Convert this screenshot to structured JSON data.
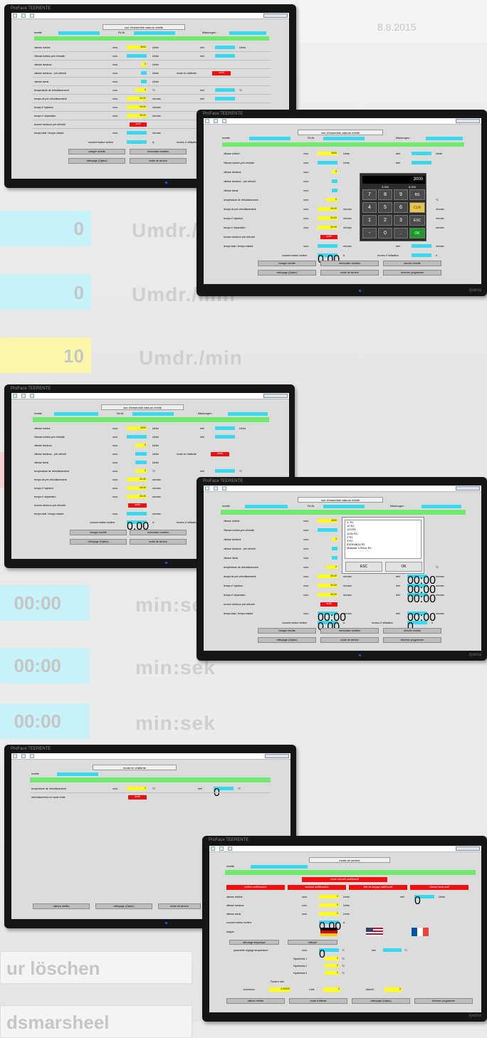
{
  "background": {
    "top_text": "8.8.2015",
    "pill_numbers": [
      "0",
      "0",
      "10"
    ],
    "units": [
      "Umdr./min",
      "Umdr./min",
      "Umdr./min"
    ],
    "times": [
      "00:00",
      "00:00",
      "00:00"
    ],
    "time_units": [
      "min:sek",
      "min:sek",
      "min:sek"
    ],
    "bottom_texts": [
      "ur löschen",
      "dsmarsheel"
    ]
  },
  "monitor": {
    "brand": "ProFace TEERENTE",
    "maker": "iiyama"
  },
  "ui": {
    "title_overview": "vue d'ensemble valeurs /réelle",
    "title_waiting": "mode en d'attente",
    "title_service": "mode de service",
    "recette": "recette",
    "fa_nr": "FA-Nr.",
    "mischungen": "Mischungen :",
    "nom": "nom.",
    "reel": "réel",
    "arret": "arrêt",
    "rows": [
      {
        "label": "vitesse turbine",
        "nom": "3000",
        "unit": "U/min",
        "reel": "0",
        "runit": "U/min"
      },
      {
        "label": "Vitesse turbine-pré-refroidie",
        "nom": "300",
        "unit": "U/min",
        "reel": "0",
        "runit": "U/min"
      },
      {
        "label": "vitesse tambour",
        "nom": "3",
        "unit": "U/min"
      },
      {
        "label": "vitesse tambour - pré-refroidi",
        "nom": "3",
        "unit": "U/min",
        "extra": "mode en d'attente"
      },
      {
        "label": "vitesse tamis",
        "nom": "3",
        "unit": "U/min"
      },
      {
        "label": "température de refroidissement",
        "nom": "0",
        "unit": "°C",
        "reel": "0",
        "runit": "°C"
      },
      {
        "label": "temps de pré-refroidissement",
        "nom": "00:00",
        "unit": "min:sec",
        "reel": "00:00",
        "runit": "min:sec"
      },
      {
        "label": "temps d' injection",
        "nom": "00:00",
        "unit": "min:sec",
        "reel": "00:00",
        "runit": "min:sec"
      },
      {
        "label": "temps d' séparation",
        "nom": "00:00",
        "unit": "min:sec",
        "reel": "00:00",
        "runit": "min:sec"
      },
      {
        "label": "tourner tambour pré-refroidir"
      },
      {
        "label": "temps total / temps restant",
        "nom": "00:00",
        "unit": "min:sec",
        "reel": "00:00",
        "runit": "min:sec"
      }
    ],
    "courant_label": "courant moteur turbine",
    "courant_value": "0,00",
    "courant_unit": "A",
    "heures_label": "heures d' utilisation",
    "heures_value": "0",
    "heures_unit": "h",
    "buttons": [
      "charger recette",
      "mémoriser recettes",
      "annuler recette",
      "nettoyage (Option)",
      "mode de service",
      "terminer programme"
    ],
    "keypad": {
      "display": "3000",
      "min": "3.000",
      "max": "6.000",
      "keys": [
        "7",
        "8",
        "9",
        "BS",
        "4",
        "5",
        "6",
        "CLR",
        "1",
        "2",
        "3",
        "ESC",
        "-",
        "0",
        ".",
        "OK"
      ]
    },
    "recipe_list": [
      "1. R1",
      "12 R1",
      "123 R1",
      "1234 R1",
      "2 R1",
      "3 R1",
      "ID0304814 R1",
      "Material 1234ov R1"
    ],
    "dialog_buttons": [
      "ESC",
      "OK"
    ],
    "waiting": {
      "row1": "température de refroidissement",
      "row1_nom": "0",
      "row1_unit": "°C",
      "row1_reel": "0",
      "row2": "refroidissement en mode d'idle",
      "bottom": [
        "valeurs réelles",
        "nettoyage (Option)",
        "mode de service"
      ]
    },
    "service": {
      "header": "mode manuel: actif/inactif",
      "toggles": [
        "turbine actif/inactive",
        "tambour actif/inactive",
        "tête de rinçage actif/inactif",
        "vitesse tamis actif"
      ],
      "rows": [
        {
          "label": "vitesse turbine",
          "nom": "0",
          "unit": "U/min",
          "reel": "0"
        },
        {
          "label": "vitesse tambour",
          "nom": "0",
          "unit": "U/min"
        },
        {
          "label": "vitesse tamis",
          "nom": "0",
          "unit": "U/min"
        }
      ],
      "courant": "courant moteur turbine",
      "courant_value": "0,00",
      "courant_unit": "A",
      "langue": "langue",
      "b1": "affichage séquelque",
      "b2": "nettoyer",
      "param": "paramètre réglage température",
      "param_nom": "0",
      "hys": [
        {
          "l": "Hystérésis 1",
          "v": "0"
        },
        {
          "l": "Hystérésis 2",
          "v": "0"
        },
        {
          "l": "Hystérésis 3",
          "v": "0"
        }
      ],
      "facteur": "Facteur mél.",
      "tournevus": "tourneaux",
      "tv_value": "0,00000",
      "limit": "Limit",
      "limit_v": "0",
      "aktuell": "Aktuell",
      "aktuell_v": "0",
      "bottom": [
        "valeurs réelles",
        "mode d'attente",
        "nettoyage (Option)",
        "terminer programme"
      ]
    }
  }
}
